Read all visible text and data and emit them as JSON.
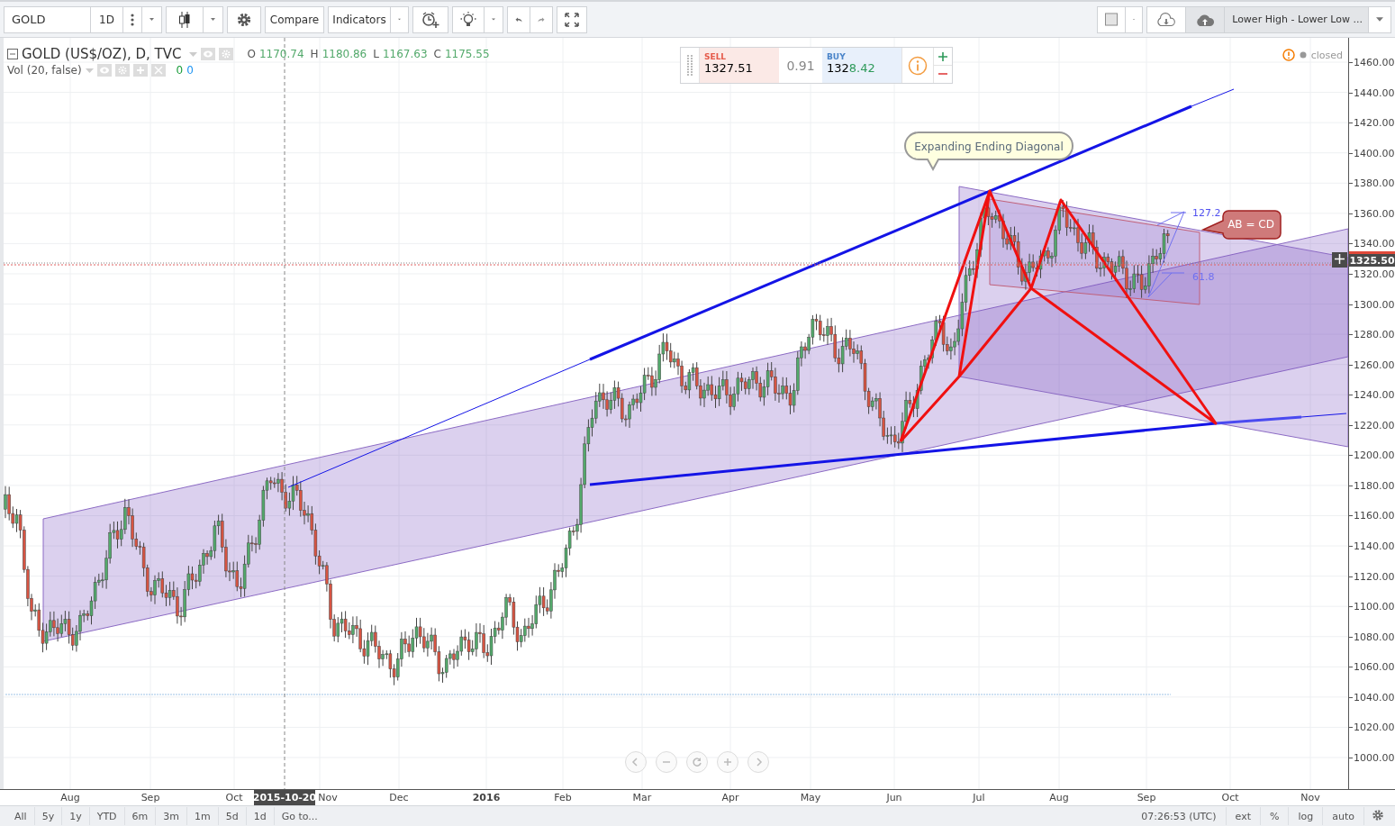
{
  "toolbar": {
    "symbol": "GOLD",
    "interval": "1D",
    "compare": "Compare",
    "indicators": "Indicators",
    "layout_name": "Lower High - Lower Low ..."
  },
  "legend": {
    "title": "GOLD (US$/OZ), D, TVC",
    "ohlc": [
      {
        "label": "O",
        "value": "1170.74"
      },
      {
        "label": "H",
        "value": "1180.86"
      },
      {
        "label": "L",
        "value": "1167.63"
      },
      {
        "label": "C",
        "value": "1175.55"
      }
    ],
    "study": "Vol (20, false)",
    "study_values": [
      {
        "value": "0",
        "color": "#1a9d3b"
      },
      {
        "value": "0",
        "color": "#2196f3"
      }
    ]
  },
  "trade": {
    "sell_label": "SELL",
    "sell_price": "1327.51",
    "spread": "0.91",
    "buy_label": "BUY",
    "buy_price": "1328.42"
  },
  "market_status": "closed",
  "annotations": {
    "callout": "Expanding Ending Diagonal",
    "pattern_label": "AB = CD",
    "fib_labels": [
      "127.2",
      "61.8"
    ]
  },
  "price_axis": {
    "ticks": [
      "1460.00",
      "1440.00",
      "1420.00",
      "1400.00",
      "1380.00",
      "1360.00",
      "1340.00",
      "1320.00",
      "1300.00",
      "1280.00",
      "1260.00",
      "1240.00",
      "1220.00",
      "1200.00",
      "1180.00",
      "1160.00",
      "1140.00",
      "1120.00",
      "1100.00",
      "1080.00",
      "1060.00",
      "1040.00",
      "1020.00",
      "1000.00"
    ],
    "current": "1325.50"
  },
  "time_axis": {
    "labels": [
      "Aug",
      "Sep",
      "Oct",
      "Nov",
      "Dec",
      "2016",
      "Feb",
      "Mar",
      "Apr",
      "May",
      "Jun",
      "Jul",
      "Aug",
      "Sep",
      "Oct",
      "Nov"
    ],
    "crosshair": "2015-10-20"
  },
  "ranges": [
    "All",
    "5y",
    "1y",
    "YTD",
    "6m",
    "3m",
    "1m",
    "5d",
    "1d"
  ],
  "goto": "Go to...",
  "clock": "07:26:53 (UTC)",
  "options": [
    "ext",
    "%",
    "log",
    "auto"
  ]
}
